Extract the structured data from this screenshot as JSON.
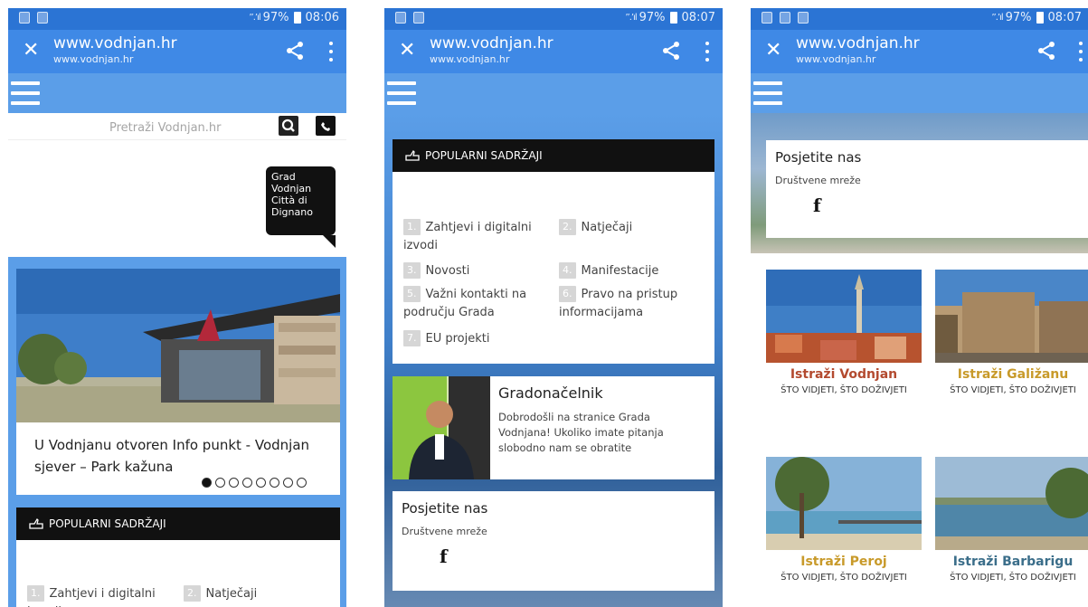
{
  "status_bars": [
    {
      "signal": "’’.’ıl",
      "battery": "97%",
      "time": "08:06"
    },
    {
      "signal": "’’.’ıl",
      "battery": "97%",
      "time": "08:07"
    },
    {
      "signal": "’’.’ıl",
      "battery": "97%",
      "time": "08:07"
    }
  ],
  "browser": {
    "url_main": "www.vodnjan.hr",
    "url_sub": "www.vodnjan.hr",
    "close_glyph": "✕"
  },
  "search": {
    "placeholder": "Pretraži Vodnjan.hr"
  },
  "badge": {
    "line1": "Grad",
    "line2": "Vodnjan",
    "line3": "Città di",
    "line4": "Dignano"
  },
  "slider": {
    "title": "U Vodnjanu otvoren Info punkt - Vodnjan sjever – Park kažuna",
    "dot_count": 8,
    "active_dot": 0
  },
  "popular": {
    "heading": "POPULARNI SADRŽAJI",
    "items": [
      {
        "num": "1.",
        "label": "Zahtjevi i digitalni izvodi"
      },
      {
        "num": "2.",
        "label": "Natječaji"
      },
      {
        "num": "3.",
        "label": "Novosti"
      },
      {
        "num": "4.",
        "label": "Manifestacije"
      },
      {
        "num": "5.",
        "label": "Važni kontakti na području Grada"
      },
      {
        "num": "6.",
        "label": "Pravo na pristup informacijama"
      },
      {
        "num": "7.",
        "label": "EU projekti"
      }
    ],
    "p1_item1_line1": "Zahtjevi i digitalni",
    "p1_item1_line2": "izvodi"
  },
  "mayor": {
    "title": "Gradonačelnik",
    "text": "Dobrodošli na stranice Grada Vodnjana! Ukoliko imate pitanja slobodno nam se obratite"
  },
  "visit": {
    "title": "Posjetite nas",
    "subtitle": "Društvene mreže",
    "fb_glyph": "f"
  },
  "explore": [
    {
      "title": "Istraži Vodnjan",
      "subtitle": "ŠTO VIDJETI, ŠTO DOŽIVJETI",
      "color": "#b34a2f"
    },
    {
      "title": "Istraži Galižanu",
      "subtitle": "ŠTO VIDJETI, ŠTO DOŽIVJETI",
      "color": "#c89a2a"
    },
    {
      "title": "Istraži Peroj",
      "subtitle": "ŠTO VIDJETI, ŠTO DOŽIVJETI",
      "color": "#c89a2a"
    },
    {
      "title": "Istraži Barbarigu",
      "subtitle": "ŠTO VIDJETI, ŠTO DOŽIVJETI",
      "color": "#3b6e8a"
    }
  ],
  "colors": {
    "status_bar": "#2b74d4",
    "url_bar": "#3f89e6",
    "menu_bar": "#5b9ee8",
    "header_black": "#111111"
  }
}
